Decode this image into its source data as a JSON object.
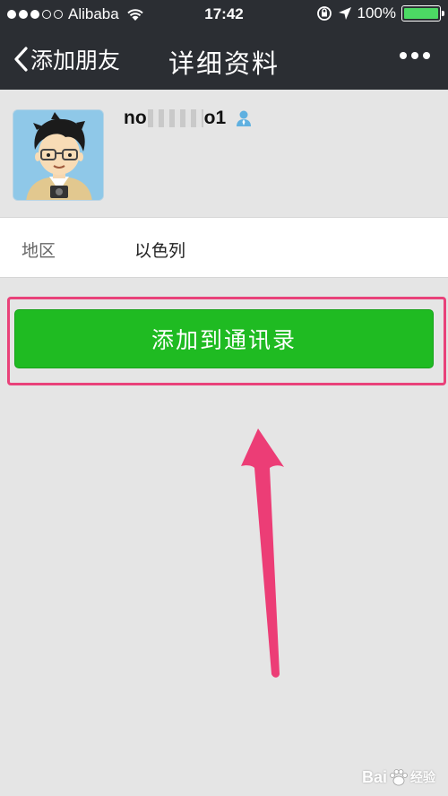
{
  "status_bar": {
    "carrier": "Alibaba",
    "time": "17:42",
    "battery": "100%",
    "battery_level": 1.0,
    "icons": [
      "signal-dots",
      "wifi-icon",
      "rotation-lock-icon",
      "location-arrow-icon",
      "battery-icon"
    ]
  },
  "nav": {
    "back_label": "添加朋友",
    "title": "详细资料",
    "more_icon": "more-dots-icon"
  },
  "profile": {
    "name_prefix": "no",
    "name_suffix": "o1",
    "gender_icon": "person-icon"
  },
  "info": {
    "label": "地区",
    "value": "以色列"
  },
  "action": {
    "add_label": "添加到通讯录"
  },
  "colors": {
    "nav_bg": "#2b2e33",
    "button_green": "#1fbb22",
    "highlight_pink": "#e9427a",
    "page_bg": "#e5e5e5"
  },
  "watermark": {
    "text": "Bai",
    "suffix": "经验"
  }
}
